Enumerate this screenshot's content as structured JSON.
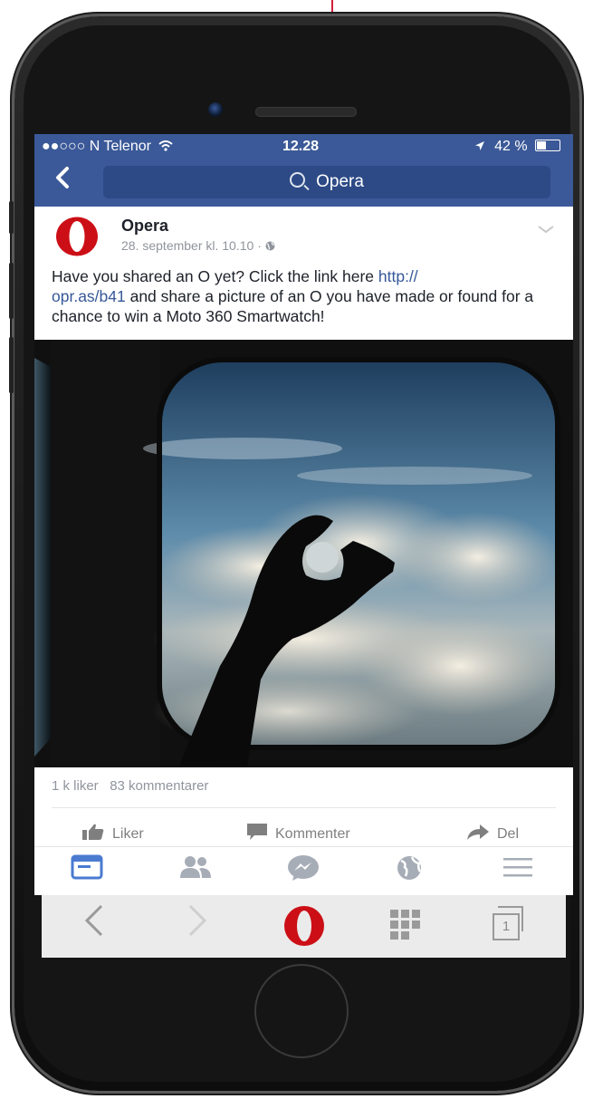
{
  "status": {
    "carrier": "●●○○○ N Telenor",
    "time": "12.28",
    "battery": "42 %",
    "battery_level": 0.42
  },
  "header": {
    "search_text": "Opera"
  },
  "post": {
    "page_name": "Opera",
    "date": "28. september kl. 10.10 · ",
    "text_before": "Have you shared an O yet? Click the link here ",
    "link": "http://\nopr.as/b41",
    "text_after": " and share a picture of an O you have made or found for a chance to win a Moto 360 Smartwatch!",
    "likes": "1 k liker",
    "comments": "83 kommentarer",
    "actions": {
      "like": "Liker",
      "comment": "Kommenter",
      "share": "Del"
    }
  },
  "tabs": [
    "news-feed",
    "friends",
    "messenger",
    "notifications",
    "more"
  ],
  "opera_bar": {
    "tab_count": "1"
  },
  "colors": {
    "facebook_blue": "#3b5998",
    "opera_red": "#cc0f16",
    "annotation_red": "#d21f3c"
  }
}
